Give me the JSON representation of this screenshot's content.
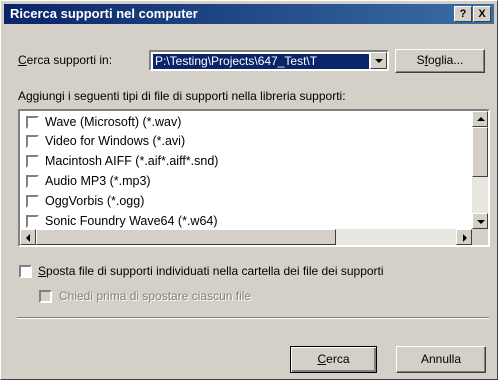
{
  "window": {
    "title": "Ricerca supporti nel computer",
    "help_button": "?",
    "close_button": "X"
  },
  "search_in": {
    "label_u": "C",
    "label_rest": "erca supporti in:",
    "value": "P:\\Testing\\Projects\\647_Test\\T",
    "browse_u": "f",
    "browse_pre": "S",
    "browse_post": "oglia..."
  },
  "file_types": {
    "label": "Aggiungi i seguenti tipi di file di supporti nella libreria supporti:",
    "items": [
      {
        "label": "Wave (Microsoft) (*.wav)",
        "checked": false
      },
      {
        "label": "Video for Windows (*.avi)",
        "checked": false
      },
      {
        "label": "Macintosh AIFF (*.aif*.aiff*.snd)",
        "checked": false
      },
      {
        "label": "Audio MP3 (*.mp3)",
        "checked": false
      },
      {
        "label": "OggVorbis (*.ogg)",
        "checked": false
      },
      {
        "label": "Sonic Foundry Wave64 (*.w64)",
        "checked": false
      }
    ]
  },
  "options": {
    "move_u": "S",
    "move_rest": "posta file di supporti individuati nella cartella dei file dei supporti",
    "ask_each": "Chiedi prima di spostare ciascun file"
  },
  "buttons": {
    "search_u": "C",
    "search_rest": "erca",
    "cancel": "Annulla"
  }
}
